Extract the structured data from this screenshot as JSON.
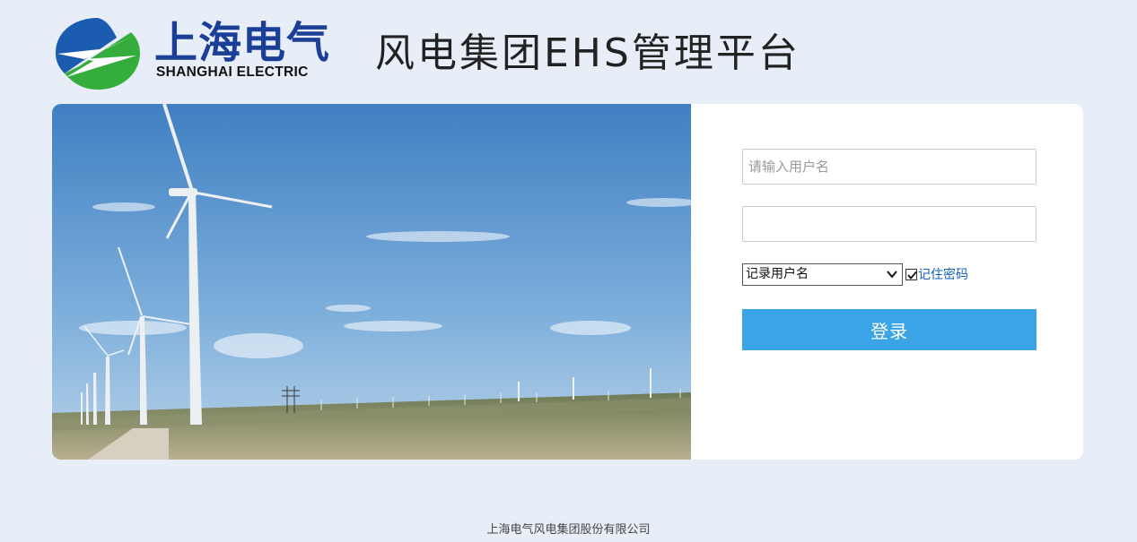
{
  "header": {
    "brand_cn": "上海电气",
    "brand_en": "SHANGHAI ELECTRIC",
    "platform_title": "风电集团EHS管理平台"
  },
  "login": {
    "username_placeholder": "请输入用户名",
    "password_value": "",
    "remember_select": {
      "selected": "记录用户名"
    },
    "remember_password_label": "记住密码",
    "remember_password_checked": true,
    "login_label": "登录"
  },
  "footer": {
    "text": "上海电气风电集团股份有限公司"
  },
  "colors": {
    "brand_blue": "#1b3f96",
    "brand_green": "#2ea83a",
    "login_button": "#3aa4e6",
    "link": "#1560b7",
    "background": "#e8eef8"
  }
}
